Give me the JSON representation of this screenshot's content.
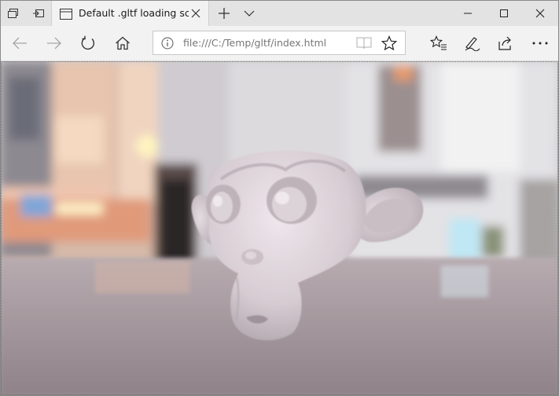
{
  "browser": {
    "tab": {
      "title": "Default .gltf loading sce",
      "icon": "page-icon",
      "close_icon": "close-icon"
    },
    "titlebar_icons": [
      "tab-preview-icon",
      "set-aside-tabs-icon",
      "new-tab-icon",
      "tab-list-chevron-icon"
    ],
    "window_controls": [
      "minimize-icon",
      "maximize-icon",
      "close-icon"
    ],
    "nav": {
      "back_icon": "back-arrow-icon",
      "forward_icon": "forward-arrow-icon",
      "refresh_icon": "refresh-icon",
      "home_icon": "home-icon"
    },
    "address": {
      "url": "file:///C:/Temp/gltf/index.html",
      "info_icon": "info-icon",
      "reading_view_icon": "reading-view-icon",
      "favorite_icon": "star-icon"
    },
    "toolbar_icons": [
      "favorites-list-icon",
      "pen-icon",
      "share-icon",
      "more-icon"
    ]
  },
  "viewport": {
    "scene": "Blurred city-street environment with a stone-textured monkey head 3D model",
    "model_color": "#d9d0d6",
    "accent": "#f28c28"
  }
}
